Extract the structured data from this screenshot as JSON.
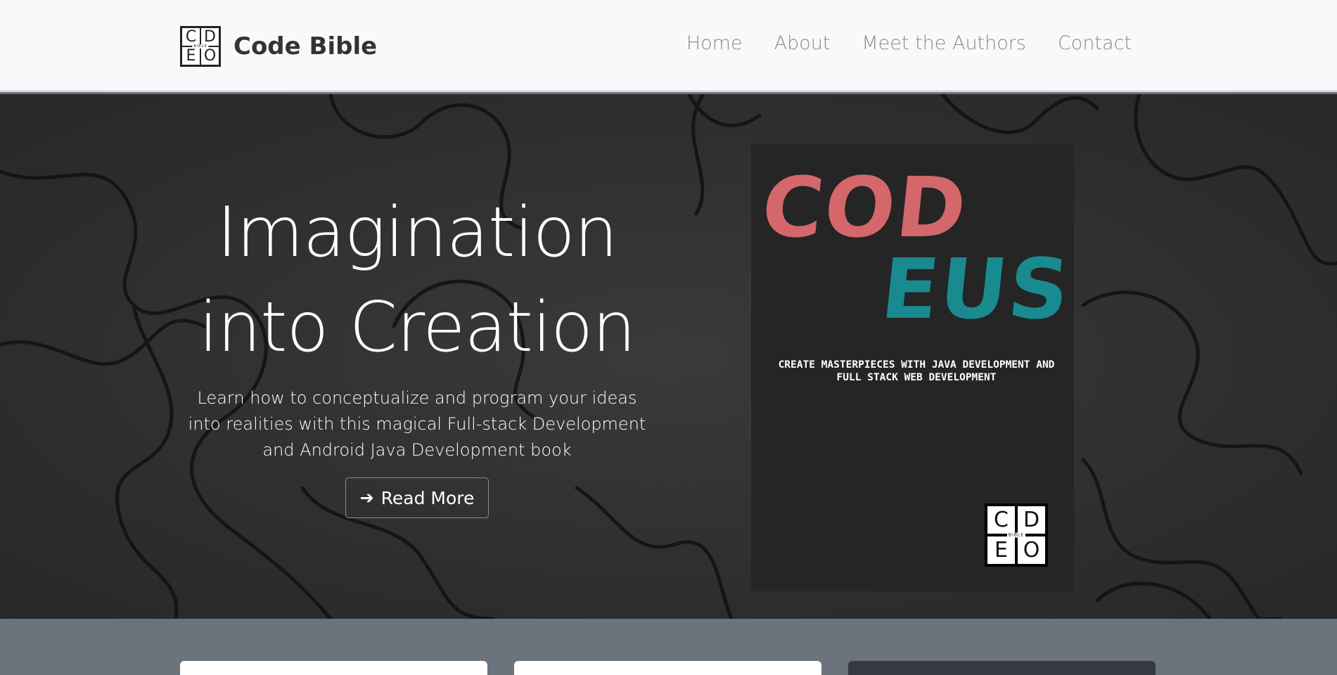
{
  "navbar": {
    "brand_name": "Code Bible",
    "logo_letters": [
      "C",
      "D",
      "E",
      "O"
    ],
    "logo_small_text": "BIBLE",
    "links": [
      {
        "label": "Home"
      },
      {
        "label": "About"
      },
      {
        "label": "Meet the Authors"
      },
      {
        "label": "Contact"
      }
    ]
  },
  "hero": {
    "title_line1": "Imagination",
    "title_line2": "into Creation",
    "subtitle": "Learn how to conceptualize and program your ideas into realities with this magical Full-stack Development and Android Java Development book",
    "button_label": "Read More",
    "button_icon": "arrow-right-icon"
  },
  "book_cover": {
    "title_part1": "COD",
    "title_part2": "EUS",
    "tagline": "CREATE MASTERPIECES WITH JAVA DEVELOPMENT AND FULL STACK WEB DEVELOPMENT",
    "logo_letters": [
      "C",
      "D",
      "E",
      "O"
    ],
    "logo_small_text": "BIBLE",
    "colors": {
      "part1": "#d4676b",
      "part2": "#198a8f",
      "background": "#252525"
    }
  },
  "colors": {
    "navbar_bg": "#f8f9fa",
    "hero_bg": "#2e2e2e",
    "section_bg": "#6b737d"
  },
  "cards": [
    {
      "color": "#ffffff"
    },
    {
      "color": "#ffffff"
    },
    {
      "color": "#343a40"
    }
  ]
}
